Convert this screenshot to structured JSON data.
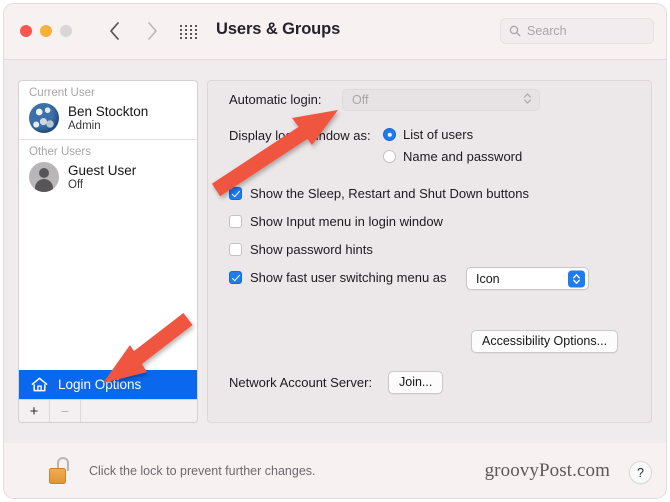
{
  "window": {
    "title": "Users & Groups",
    "traffic_lights": [
      "close",
      "minimize",
      "zoom"
    ],
    "back_label": "Back",
    "forward_label": "Forward",
    "grid_label": "Show All",
    "search": {
      "placeholder": "Search",
      "value": "",
      "icon": "search-icon"
    }
  },
  "sidebar": {
    "groups": [
      {
        "header": "Current User",
        "users": [
          {
            "name": "Ben Stockton",
            "status": "Admin",
            "avatar": "earth-globe-avatar"
          }
        ]
      },
      {
        "header": "Other Users",
        "users": [
          {
            "name": "Guest User",
            "status": "Off",
            "avatar": "generic-person-avatar"
          }
        ]
      }
    ],
    "login_options": {
      "label": "Login Options",
      "icon": "home-icon",
      "selected": true,
      "selection_color": "#0a68ef"
    },
    "toolbar": {
      "add_label": "+",
      "remove_label": "−",
      "add_enabled": true,
      "remove_enabled": false
    }
  },
  "main": {
    "automatic_login": {
      "label": "Automatic login:",
      "value": "Off",
      "enabled": false,
      "options": [
        "Off"
      ]
    },
    "display_login_window": {
      "label": "Display login window as:",
      "options": [
        {
          "label": "List of users",
          "selected": true
        },
        {
          "label": "Name and password",
          "selected": false
        }
      ]
    },
    "checkboxes": [
      {
        "label": "Show the Sleep, Restart and Shut Down buttons",
        "checked": true
      },
      {
        "label": "Show Input menu in login window",
        "checked": false
      },
      {
        "label": "Show password hints",
        "checked": false
      }
    ],
    "fast_user_switching": {
      "label": "Show fast user switching menu as",
      "checked": true,
      "value": "Icon",
      "options": [
        "Icon"
      ]
    },
    "accessibility_button": "Accessibility Options...",
    "network_account_server": {
      "label": "Network Account Server:",
      "button": "Join..."
    }
  },
  "bottom": {
    "lock_icon": "unlocked-padlock-icon",
    "lock_text": "Click the lock to prevent further changes.",
    "watermark": "groovyPost.com",
    "help_label": "?"
  },
  "annotations": {
    "arrow_color": "#f0553f",
    "arrows": [
      {
        "name": "arrow-to-automatic-login",
        "points_to": "automatic-login-dropdown"
      },
      {
        "name": "arrow-to-login-options",
        "points_to": "sidebar-item-login-options"
      }
    ]
  }
}
